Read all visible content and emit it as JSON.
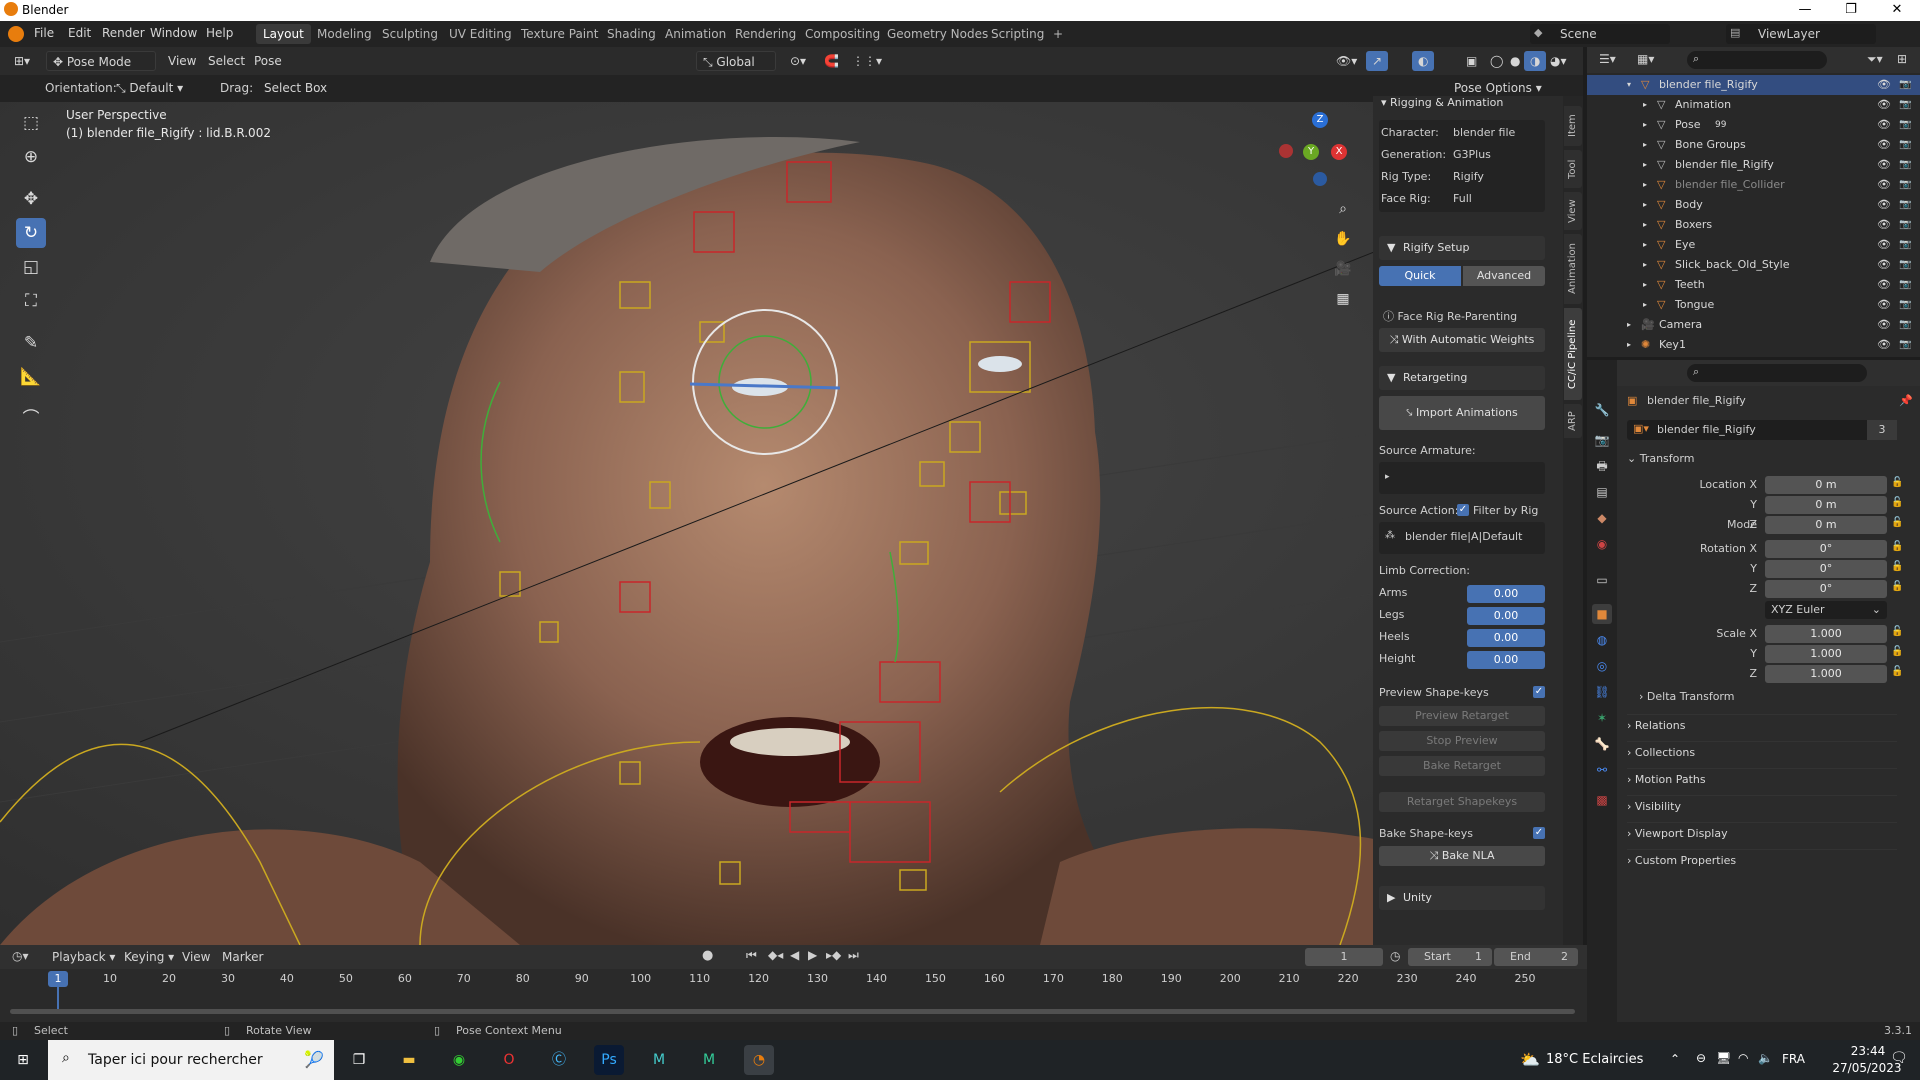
{
  "window": {
    "title": "Blender",
    "minimize": "—",
    "restore": "❐",
    "close": "✕"
  },
  "menu": [
    "File",
    "Edit",
    "Render",
    "Window",
    "Help"
  ],
  "workspaces": [
    "Layout",
    "Modeling",
    "Sculpting",
    "UV Editing",
    "Texture Paint",
    "Shading",
    "Animation",
    "Rendering",
    "Compositing",
    "Geometry Nodes",
    "Scripting",
    "+"
  ],
  "active_workspace": "Layout",
  "scene": "Scene",
  "view_layer": "ViewLayer",
  "viewport_header": {
    "mode": "Pose Mode",
    "view": "View",
    "select": "Select",
    "pose": "Pose",
    "transform": "Global",
    "orientation_label": "Orientation:",
    "orientation_value": "Default",
    "drag_label": "Drag:",
    "drag_value": "Select Box",
    "pose_options": "Pose Options"
  },
  "viewport_overlay": {
    "perspective": "User Perspective",
    "active": "(1) blender file_Rigify : lid.B.R.002"
  },
  "gizmo": {
    "x": "X",
    "y": "Y",
    "z": "Z"
  },
  "npanel": {
    "section": "Rigging & Animation",
    "info": [
      {
        "label": "Character:",
        "value": "blender file"
      },
      {
        "label": "Generation:",
        "value": "G3Plus"
      },
      {
        "label": "Rig Type:",
        "value": "Rigify"
      },
      {
        "label": "Face Rig:",
        "value": "Full"
      }
    ],
    "rigify_setup": "Rigify Setup",
    "quick": "Quick",
    "advanced": "Advanced",
    "face_rig_reparent": "Face Rig Re-Parenting",
    "with_auto_weights": "With Automatic Weights",
    "retargeting": "Retargeting",
    "import_animations": "Import Animations",
    "source_armature": "Source Armature:",
    "source_action": "Source Action:",
    "filter_by_rig": "Filter by Rig",
    "action_value": "blender file|A|Default",
    "limb_correction": "Limb Correction:",
    "limbs": [
      {
        "label": "Arms",
        "value": "0.00"
      },
      {
        "label": "Legs",
        "value": "0.00"
      },
      {
        "label": "Heels",
        "value": "0.00"
      },
      {
        "label": "Height",
        "value": "0.00"
      }
    ],
    "preview_shapekeys": "Preview Shape-keys",
    "preview_retarget": "Preview Retarget",
    "stop_preview": "Stop Preview",
    "bake_retarget": "Bake Retarget",
    "retarget_shapekeys": "Retarget Shapekeys",
    "bake_shapekeys": "Bake Shape-keys",
    "bake_nla": "Bake NLA",
    "unity": "Unity"
  },
  "side_tabs": [
    "Item",
    "Tool",
    "View",
    "Animation",
    "CC/iC Pipeline",
    "ARP"
  ],
  "outliner": {
    "rows": [
      {
        "name": "blender file_Rigify",
        "depth": 2,
        "selected": true,
        "icon": "armature-icon",
        "color": "#e0883a"
      },
      {
        "name": "Animation",
        "depth": 3,
        "icon": "action-icon",
        "color": "#bbbbbb"
      },
      {
        "name": "Pose",
        "depth": 3,
        "icon": "pose-icon",
        "badge": "99",
        "color": "#bbbbbb"
      },
      {
        "name": "Bone Groups",
        "depth": 3,
        "icon": "bone-group-icon",
        "color": "#bbbbbb"
      },
      {
        "name": "blender file_Rigify",
        "depth": 3,
        "icon": "armature-data-icon",
        "color": "#bbbbbb"
      },
      {
        "name": "blender file_Collider",
        "depth": 3,
        "icon": "mesh-icon",
        "dim": true,
        "color": "#e0883a"
      },
      {
        "name": "Body",
        "depth": 3,
        "icon": "mesh-icon",
        "color": "#e0883a"
      },
      {
        "name": "Boxers",
        "depth": 3,
        "icon": "mesh-icon",
        "color": "#e0883a"
      },
      {
        "name": "Eye",
        "depth": 3,
        "icon": "mesh-icon",
        "color": "#e0883a"
      },
      {
        "name": "Slick_back_Old_Style",
        "depth": 3,
        "icon": "mesh-icon",
        "color": "#e0883a"
      },
      {
        "name": "Teeth",
        "depth": 3,
        "icon": "mesh-icon",
        "color": "#e0883a"
      },
      {
        "name": "Tongue",
        "depth": 3,
        "icon": "mesh-icon",
        "color": "#e0883a"
      },
      {
        "name": "Camera",
        "depth": 2,
        "icon": "camera-icon",
        "color": "#e0883a"
      },
      {
        "name": "Key1",
        "depth": 2,
        "icon": "light-icon",
        "color": "#e0883a"
      }
    ]
  },
  "properties": {
    "object_name": "blender file_Rigify",
    "data_name": "blender file_Rigify",
    "users": "3",
    "transform": "Transform",
    "location": [
      {
        "label": "Location X",
        "value": "0 m"
      },
      {
        "label": "Y",
        "value": "0 m"
      },
      {
        "label": "Z",
        "value": "0 m"
      }
    ],
    "rotation": [
      {
        "label": "Rotation X",
        "value": "0°"
      },
      {
        "label": "Y",
        "value": "0°"
      },
      {
        "label": "Z",
        "value": "0°"
      }
    ],
    "mode_label": "Mode",
    "mode_value": "XYZ Euler",
    "scale": [
      {
        "label": "Scale X",
        "value": "1.000"
      },
      {
        "label": "Y",
        "value": "1.000"
      },
      {
        "label": "Z",
        "value": "1.000"
      }
    ],
    "delta": "Delta Transform",
    "sections": [
      "Relations",
      "Collections",
      "Motion Paths",
      "Visibility",
      "Viewport Display",
      "Custom Properties"
    ]
  },
  "timeline": {
    "playback": "Playback",
    "keying": "Keying",
    "view": "View",
    "marker": "Marker",
    "current": "1",
    "start_label": "Start",
    "start": "1",
    "end_label": "End",
    "end": "2",
    "ticks": [
      "1",
      "10",
      "20",
      "30",
      "40",
      "50",
      "60",
      "70",
      "80",
      "90",
      "100",
      "110",
      "120",
      "130",
      "140",
      "150",
      "160",
      "170",
      "180",
      "190",
      "200",
      "210",
      "220",
      "230",
      "240",
      "250"
    ]
  },
  "statusbar": {
    "select": "Select",
    "rotate": "Rotate View",
    "context": "Pose Context Menu",
    "version": "3.3.1"
  },
  "taskbar": {
    "search": "Taper ici pour rechercher",
    "weather": "18°C  Eclaircies",
    "lang": "FRA",
    "time": "23:44",
    "date": "27/05/2023",
    "apps": [
      "task-view-icon",
      "file-explorer-icon",
      "chrome-icon",
      "opera-icon",
      "c-app-icon",
      "photoshop-icon",
      "m-app-icon",
      "m-app-icon-2",
      "blender-icon"
    ]
  }
}
